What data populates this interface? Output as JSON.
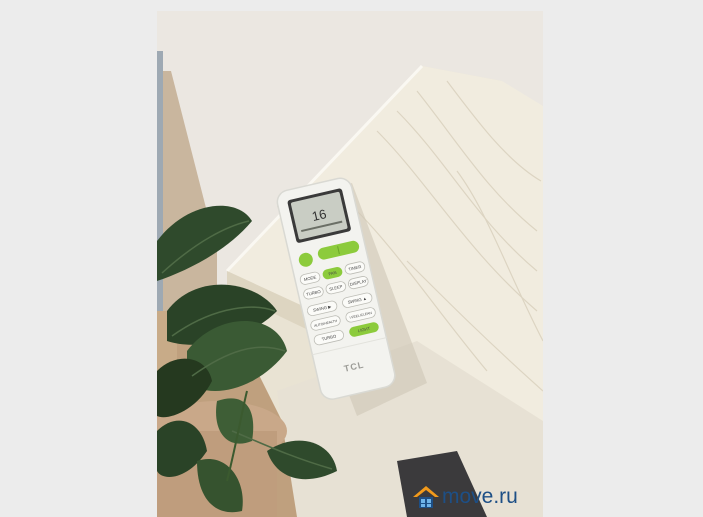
{
  "remote": {
    "brand": "TCL",
    "display_temp": "16",
    "buttons": {
      "mode": "MODE",
      "fan": "FAN",
      "sleep": "SLEEP",
      "timer": "TIMER",
      "turbo": "TURBO",
      "display": "DISPLAY",
      "swing_v": "SWING ▲",
      "swing_h": "SWING ▶",
      "auto_health": "AUTO/HEALTH",
      "i_feel": "I FEEL/CLEAN",
      "light": "LIGHT",
      "turbo2": "TURBO"
    }
  },
  "watermark": {
    "text": "move.ru",
    "logo_icon": "house-logo-icon"
  },
  "colors": {
    "remote_body": "#f3f3ef",
    "accent_green": "#8ccb3c",
    "lcd": "#c9cdc4",
    "wall": "#ece8e2",
    "table": "#efe9d8",
    "floor": "#b89a7a",
    "leaf": "#2e4a2a",
    "watermark_blue": "#1d4f86",
    "watermark_orange": "#f29a1b"
  }
}
